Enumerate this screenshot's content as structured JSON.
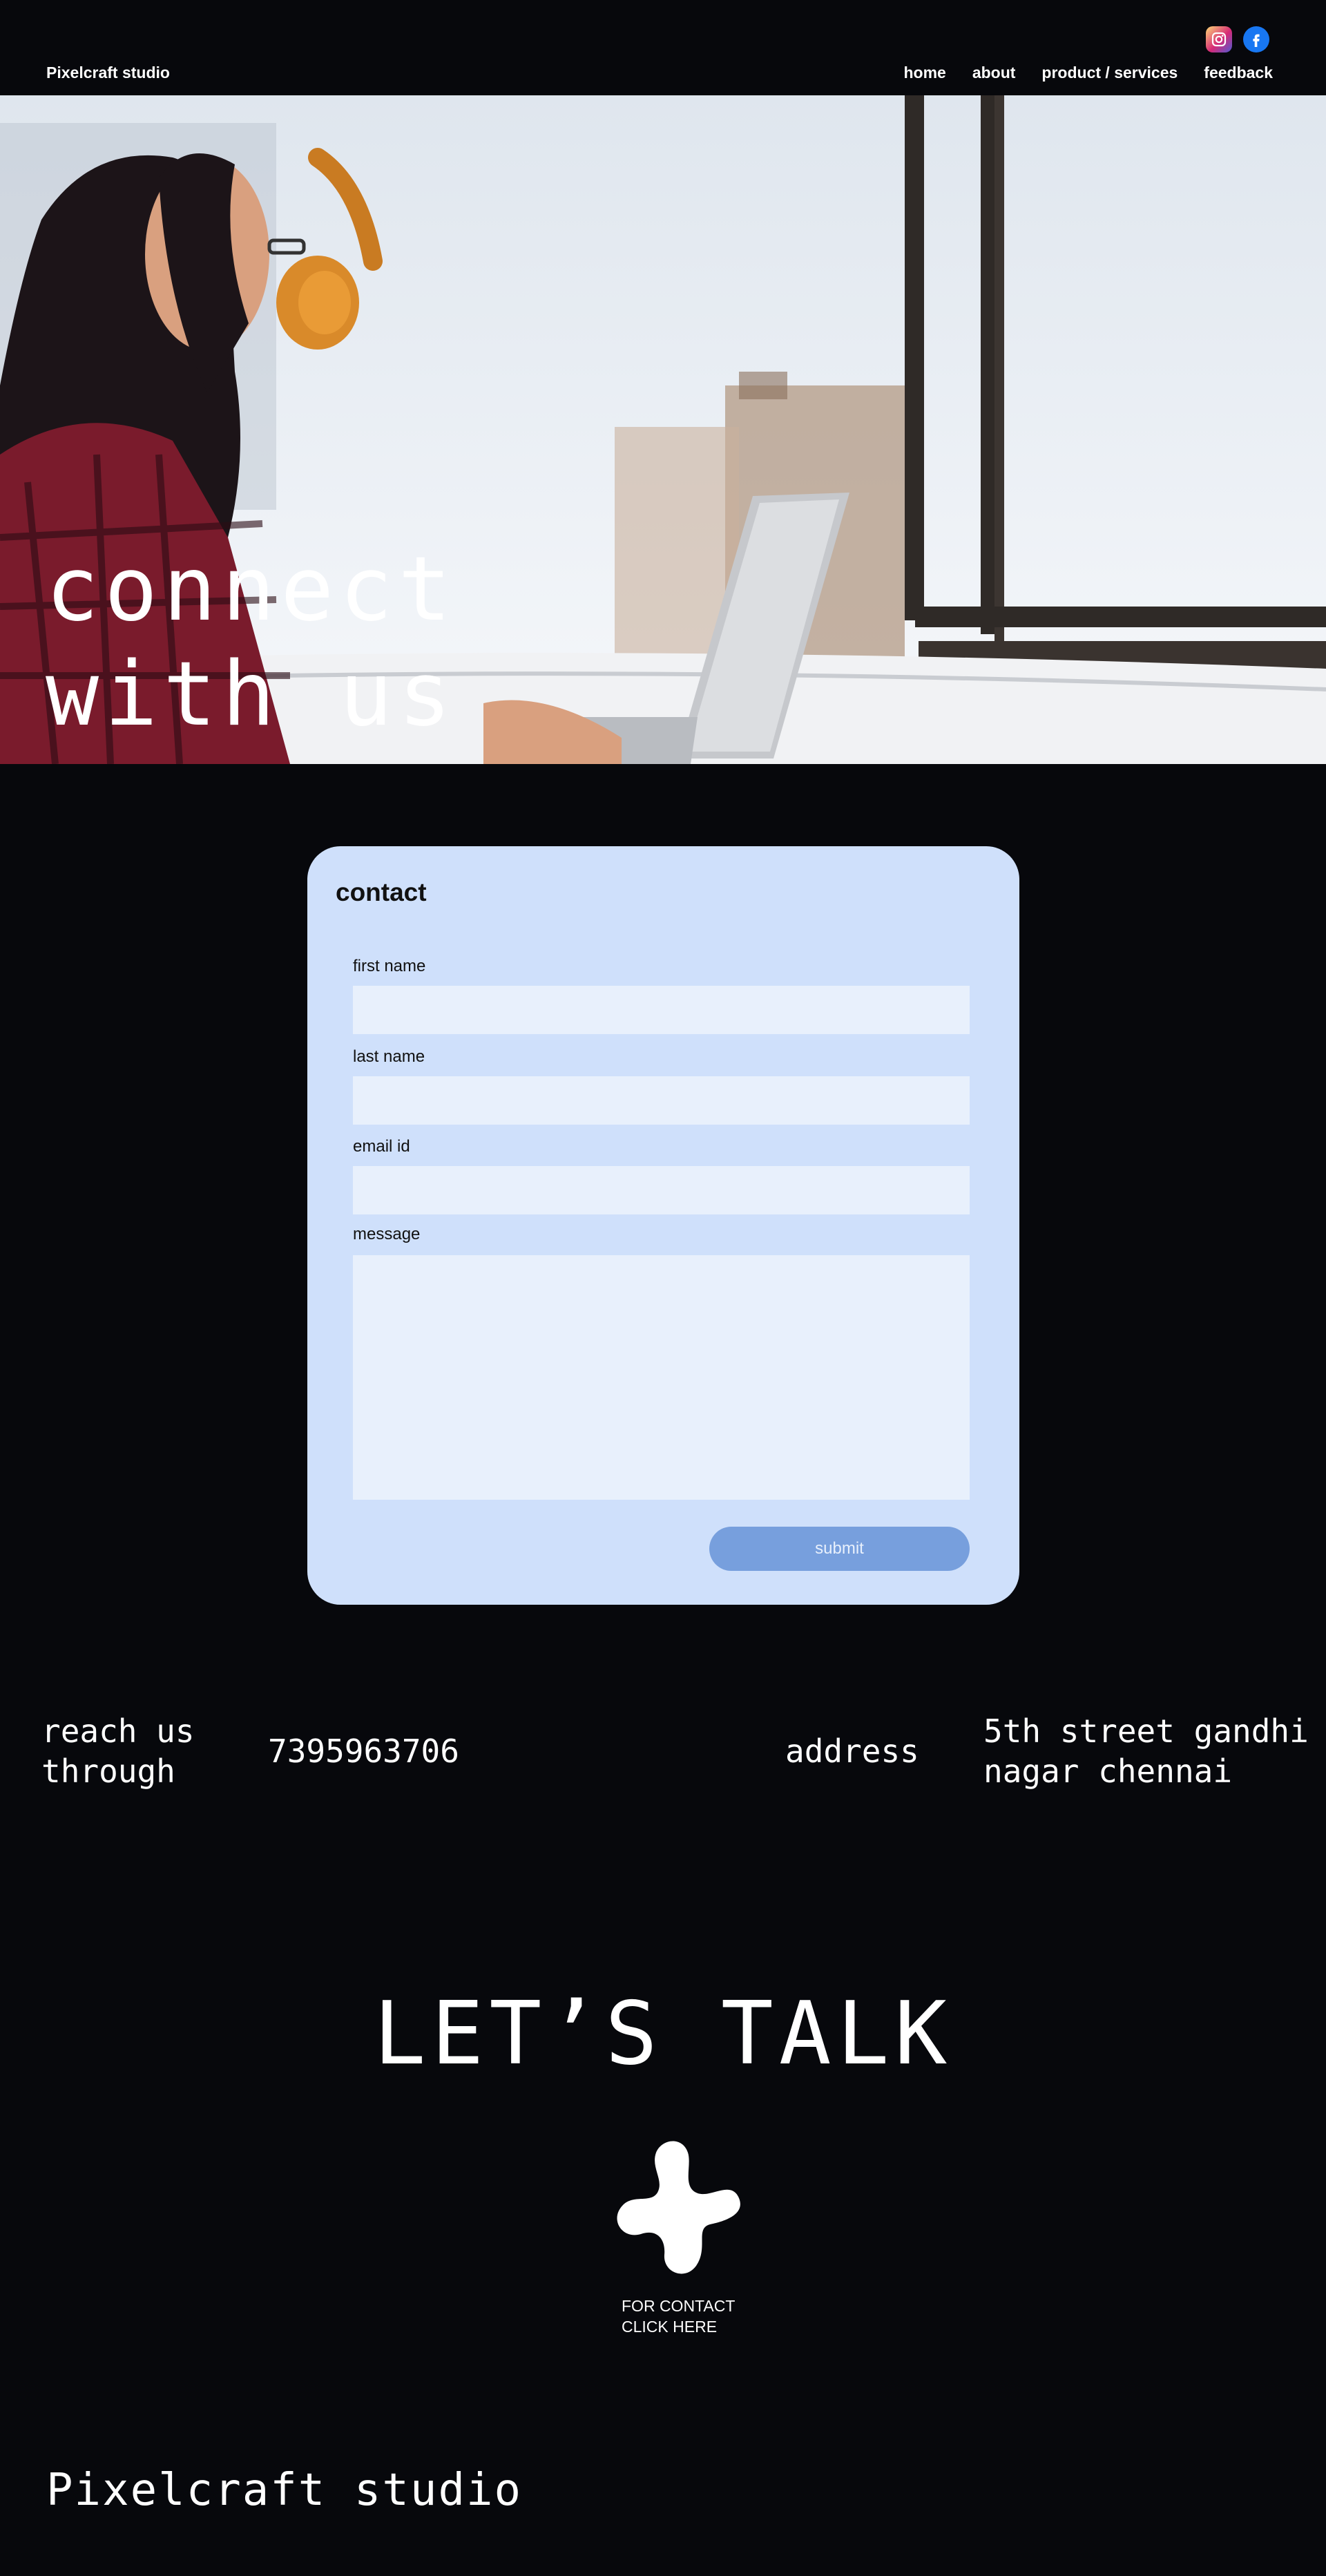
{
  "header": {
    "brand": "Pixelcraft studio",
    "social": [
      {
        "icon": "instagram-icon"
      },
      {
        "icon": "facebook-icon"
      }
    ],
    "nav": [
      "home",
      "about",
      "product / services",
      "feedback"
    ]
  },
  "hero": {
    "title": "connect\nwith us",
    "image": "woman-with-headphones-on-laptop"
  },
  "contact": {
    "title": "contact",
    "fields": [
      {
        "label": "first name",
        "value": "",
        "placeholder": ""
      },
      {
        "label": "last name",
        "value": "",
        "placeholder": ""
      },
      {
        "label": "email id",
        "value": "",
        "placeholder": ""
      },
      {
        "label": "message",
        "value": "",
        "placeholder": ""
      }
    ],
    "submit_label": "submit"
  },
  "reach": {
    "label": "reach us\nthrough",
    "phone": "7395963706",
    "address_label": "address",
    "address": "5th street gandhi\nnagar chennai"
  },
  "talk": {
    "title": "LET’S TALK",
    "cta": "FOR CONTACT\nCLICK HERE"
  },
  "footer": {
    "brand": "Pixelcraft studio"
  },
  "colors": {
    "background": "#07080c",
    "card": "#cfe0fb",
    "field": "#e8f0fc",
    "button": "#779fdd"
  }
}
